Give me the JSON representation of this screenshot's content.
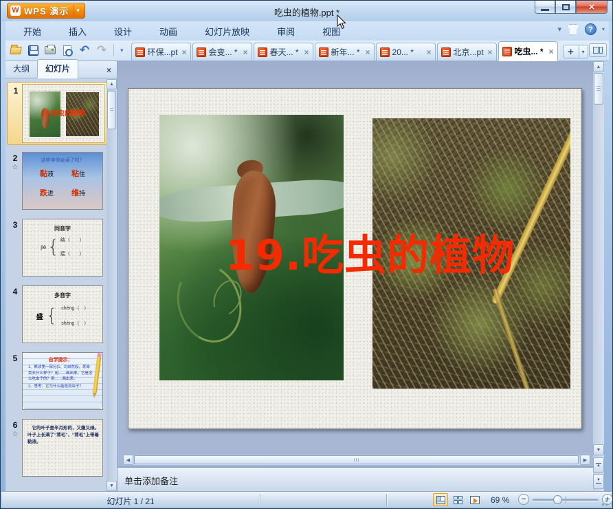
{
  "window": {
    "app_name": "WPS 演示",
    "title": "吃虫的植物.ppt *"
  },
  "menu": {
    "items": [
      "开始",
      "插入",
      "设计",
      "动画",
      "幻灯片放映",
      "审阅",
      "视图"
    ]
  },
  "doc_tabs": [
    {
      "label": "环保...pt"
    },
    {
      "label": "会变... *"
    },
    {
      "label": "春天... *"
    },
    {
      "label": "新年... *"
    },
    {
      "label": "20... *"
    },
    {
      "label": "北京...pt"
    },
    {
      "label": "吃虫... *"
    }
  ],
  "panel": {
    "tab_outline": "大纲",
    "tab_slides": "幻灯片"
  },
  "thumbnails": [
    {
      "number": "1",
      "star": "",
      "title": "19.吃虫的植物"
    },
    {
      "number": "2",
      "star": "☆",
      "heading": "这些字你会读了吗？",
      "w1r": "黏",
      "w1b": "液",
      "w2r": "粘",
      "w2b": "住",
      "w3r": "跌",
      "w3b": "进",
      "w4r": "维",
      "w4b": "持"
    },
    {
      "number": "3",
      "star": "",
      "heading": "同音字",
      "pinyin": "jiē",
      "e1": "结（　　）",
      "e2": "接（　　）"
    },
    {
      "number": "4",
      "star": "",
      "heading": "多音字",
      "char": "盛",
      "e1": "chéng（　）",
      "e2": "shèng（　）"
    },
    {
      "number": "5",
      "star": "",
      "heading": "自学提示：",
      "line1": "1、默读第一部分(1、2)自然段，茅膏菜长什么样子？用——画出来。它是怎么吃虫子的？用……画出来。",
      "line2": "2、思考：它为什么能吃到虫子？"
    },
    {
      "number": "6",
      "star": "☆",
      "body": "它的叶子是半月形的，又嫩又绿。叶子上长满了“茸毛”，“茸毛”上带着黏液。"
    }
  ],
  "slide": {
    "title": "19.吃虫的植物"
  },
  "notes": {
    "placeholder": "单击添加备注"
  },
  "status": {
    "slide_info": "幻灯片 1 / 21",
    "zoom_level": "69 %"
  },
  "ui": {
    "close": "×",
    "star": "☆",
    "plus": "+",
    "minus": "−",
    "help": "?",
    "arrow_up": "▲",
    "arrow_down": "▼",
    "arrow_left": "◀",
    "arrow_right": "▶",
    "chevron_down": "▾",
    "undo": "↶",
    "redo": "↷",
    "brace": "{"
  },
  "colors": {
    "accent_orange": "#f58d11",
    "title_red": "#f42b00",
    "selection_border": "#cfa352"
  }
}
